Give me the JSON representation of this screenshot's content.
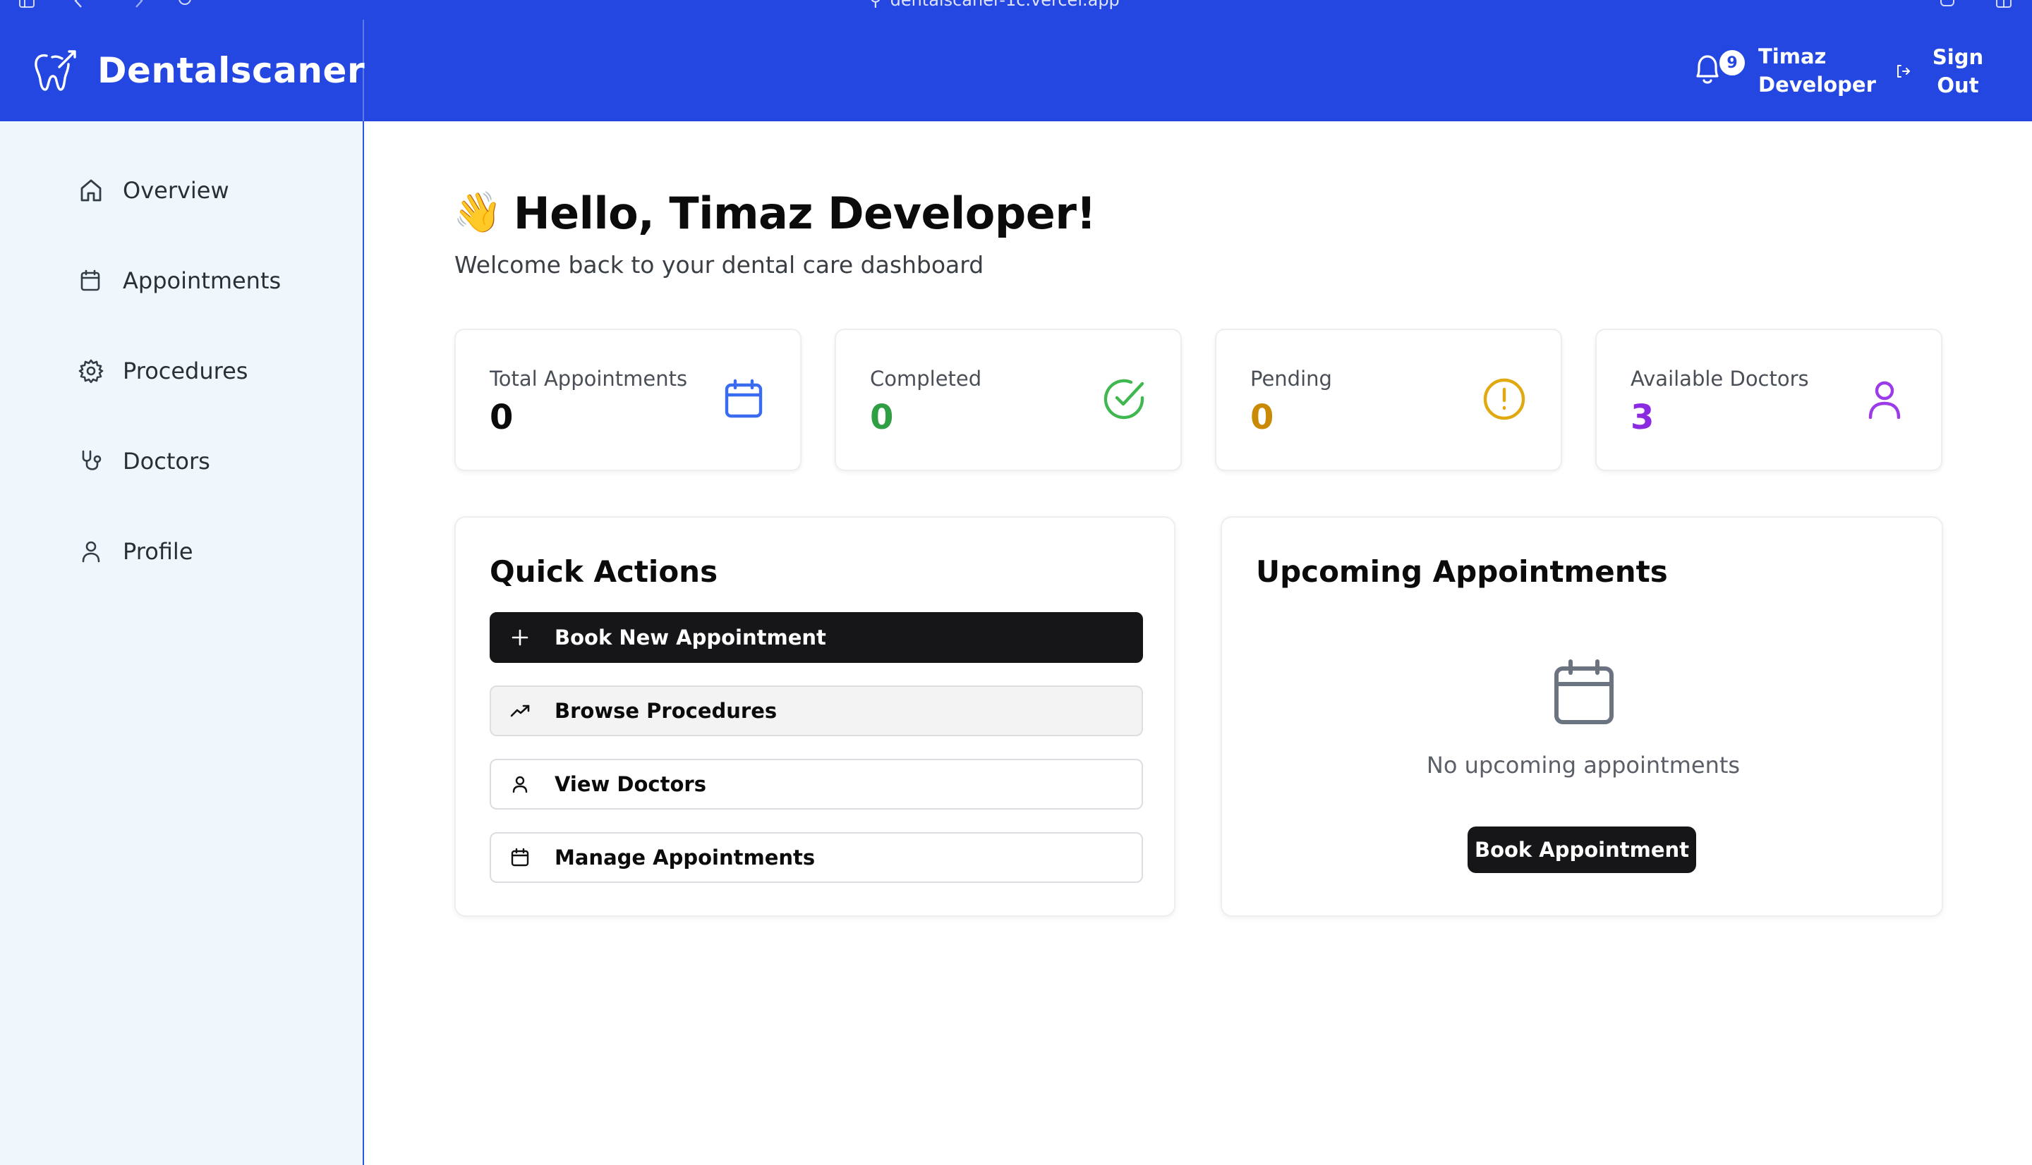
{
  "browser": {
    "url": "dentalscaner-1c.vercel.app"
  },
  "header": {
    "brand": "Dentalscaner",
    "notifications_count": "9",
    "user_name": "Timaz Developer",
    "sign_out_label": "Sign Out"
  },
  "sidebar": {
    "items": [
      {
        "label": "Overview",
        "icon": "home-icon"
      },
      {
        "label": "Appointments",
        "icon": "calendar-icon"
      },
      {
        "label": "Procedures",
        "icon": "gear-icon"
      },
      {
        "label": "Doctors",
        "icon": "stethoscope-icon"
      },
      {
        "label": "Profile",
        "icon": "user-icon"
      }
    ]
  },
  "main": {
    "greeting_emoji": "👋",
    "greeting": "Hello, Timaz Developer!",
    "subtitle": "Welcome back to your dental care dashboard",
    "stats": [
      {
        "label": "Total Appointments",
        "value": "0",
        "color": "#0b0b0c",
        "icon": "calendar-icon",
        "icon_color": "#3b6cf0"
      },
      {
        "label": "Completed",
        "value": "0",
        "color": "#2f9e44",
        "icon": "check-circle-icon",
        "icon_color": "#3fb84f"
      },
      {
        "label": "Pending",
        "value": "0",
        "color": "#c98a06",
        "icon": "alert-circle-icon",
        "icon_color": "#e0a90f"
      },
      {
        "label": "Available Doctors",
        "value": "3",
        "color": "#8a2be2",
        "icon": "user-icon",
        "icon_color": "#9b3bea"
      }
    ],
    "quick_actions": {
      "title": "Quick Actions",
      "buttons": [
        {
          "label": "Book New Appointment",
          "icon": "plus-icon"
        },
        {
          "label": "Browse Procedures",
          "icon": "trending-up-icon"
        },
        {
          "label": "View Doctors",
          "icon": "user-icon"
        },
        {
          "label": "Manage Appointments",
          "icon": "calendar-icon"
        }
      ]
    },
    "upcoming": {
      "title": "Upcoming Appointments",
      "empty_text": "No upcoming appointments",
      "button_label": "Book Appointment"
    }
  },
  "colors": {
    "brand_blue": "#2347e0",
    "sidebar_bg": "#eff6fc",
    "primary_button": "#161618"
  }
}
